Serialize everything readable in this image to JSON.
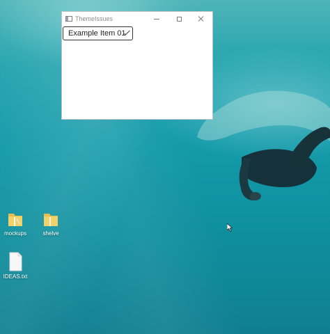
{
  "window": {
    "title": "ThemeIssues",
    "combo_value": "Example Item 01"
  },
  "desktop_icons": [
    {
      "label": "mockups",
      "icon": "folder-icon"
    },
    {
      "label": "shelve",
      "icon": "folder-icon"
    },
    {
      "label": "IDEAS.txt",
      "icon": "text-file-icon"
    }
  ],
  "colors": {
    "wallpaper_top": "#4fb5b8",
    "wallpaper_bottom": "#0f7f90",
    "window_border": "#bcc6cc",
    "title_text": "#8c8c8c"
  }
}
